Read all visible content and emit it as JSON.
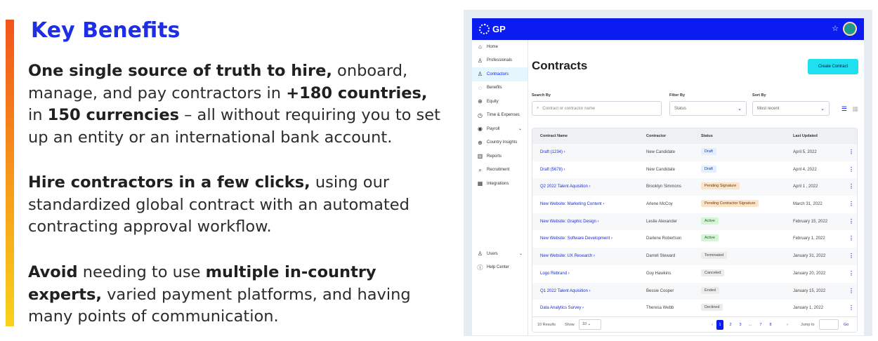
{
  "marketing": {
    "title": "Key Benefits",
    "p1": {
      "b1": "One single source of truth to hire,",
      "t1": " onboard, manage, and pay contractors in ",
      "b2": "+180 countries,",
      "t2": " in ",
      "b3": "150 currencies",
      "t3": " – all without requiring you to set up an entity or an international bank account."
    },
    "p2": {
      "b1": "Hire contractors in a few clicks,",
      "t1": " using our standardized global contract with an automated contracting approval workflow."
    },
    "p3": {
      "b1": "Avoid",
      "t1": " needing to use ",
      "b2": "multiple in-country experts,",
      "t2": " varied payment platforms, and having many points of communication."
    }
  },
  "app": {
    "logo": "GP",
    "star_icon": "☆",
    "sidebar": [
      {
        "label": "Home",
        "icon": "⌂"
      },
      {
        "label": "Professionals",
        "icon": "♙"
      },
      {
        "label": "Contractors",
        "icon": "♙"
      },
      {
        "label": "Benefits",
        "icon": "◌"
      },
      {
        "label": "Equity",
        "icon": "⊕"
      },
      {
        "label": "Time & Expenses",
        "icon": "◷"
      },
      {
        "label": "Payroll",
        "icon": "◉"
      },
      {
        "label": "Country Insights",
        "icon": "⊕"
      },
      {
        "label": "Reports",
        "icon": "▥"
      },
      {
        "label": "Recruitment",
        "icon": "⌕"
      },
      {
        "label": "Integrations",
        "icon": "▦"
      }
    ],
    "sidebar_bottom": [
      {
        "label": "Users",
        "icon": "♙"
      },
      {
        "label": "Help Center",
        "icon": "ⓘ"
      }
    ],
    "page_title": "Contracts",
    "create_button": "Create Contract",
    "search_by_label": "Search By",
    "search_placeholder": "Contract or contractor name",
    "filter_by_label": "Filter By",
    "filter_value": "Status",
    "sort_by_label": "Sort By",
    "sort_value": "Most recent",
    "table": {
      "headers": [
        "Contract Name",
        "Contractor",
        "Status",
        "Last Updated"
      ],
      "rows": [
        {
          "name": "Draft (1234)",
          "contractor": "New Candidate",
          "status": "Draft",
          "date": "April 5, 2022"
        },
        {
          "name": "Draft (5678)",
          "contractor": "New Candidate",
          "status": "Draft",
          "date": "April 4, 2022"
        },
        {
          "name": "Q2 2022 Talent Aquisition",
          "contractor": "Brooklyn Simmons",
          "status": "Pending Signature",
          "date": "April 1 , 2022"
        },
        {
          "name": "New Website: Marketing Content",
          "contractor": "Arlene McCoy",
          "status": "Pending Contractor Signature",
          "date": "March 31, 2022"
        },
        {
          "name": "New Website: Graphic Design",
          "contractor": "Leslie Alexander",
          "status": "Active",
          "date": "February 15, 2022"
        },
        {
          "name": "New Website: Software Development",
          "contractor": "Darlene Robertson",
          "status": "Active",
          "date": "February 1, 2022"
        },
        {
          "name": "New Website: UX Research",
          "contractor": "Darrell Steward",
          "status": "Terminated",
          "date": "January 31, 2022"
        },
        {
          "name": "Logo Rebrand",
          "contractor": "Guy Hawkins",
          "status": "Canceled",
          "date": "January 20, 2022"
        },
        {
          "name": "Q1 2022 Talent Aquisition",
          "contractor": "Bessie Cooper",
          "status": "Ended",
          "date": "January 15, 2022"
        },
        {
          "name": "Data Analytics Survey",
          "contractor": "Theresa Webb",
          "status": "Declined",
          "date": "January 1, 2022"
        }
      ]
    },
    "status_colors": {
      "Draft": {
        "bg": "#e3efff",
        "fg": "#1b3a9e"
      },
      "Pending Signature": {
        "bg": "#fbe3c8",
        "fg": "#6b3a0a"
      },
      "Pending Contractor Signature": {
        "bg": "#fbe3c8",
        "fg": "#6b3a0a"
      },
      "Active": {
        "bg": "#d6f5d6",
        "fg": "#1c6b1c"
      },
      "Terminated": {
        "bg": "#ececec",
        "fg": "#444444"
      },
      "Canceled": {
        "bg": "#ececec",
        "fg": "#444444"
      },
      "Ended": {
        "bg": "#ececec",
        "fg": "#444444"
      },
      "Declined": {
        "bg": "#ececec",
        "fg": "#444444"
      }
    },
    "pagination": {
      "results": "10 Results",
      "show_label": "Show",
      "page_size": "10",
      "prev": "‹",
      "pages": [
        "1",
        "2",
        "3",
        "...",
        "7",
        "8"
      ],
      "next": "›",
      "jump_label": "Jump to",
      "go": "Go"
    }
  }
}
